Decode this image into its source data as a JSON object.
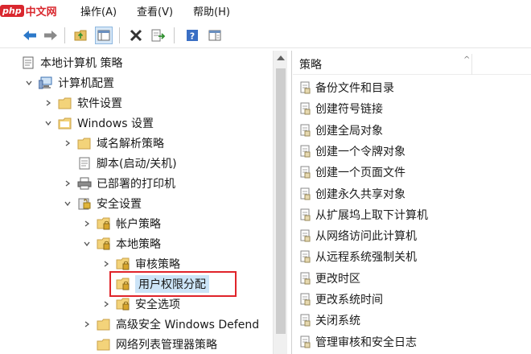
{
  "brand": {
    "badge": "php",
    "text": "中文网"
  },
  "menubar": {
    "items": [
      "操作(A)",
      "查看(V)",
      "帮助(H)"
    ]
  },
  "toolbar": {
    "icons": [
      "back-arrow-icon",
      "forward-arrow-icon",
      "up-folder-icon",
      "show-hide-tree-icon",
      "delete-icon",
      "export-list-icon",
      "help-icon",
      "properties-icon"
    ]
  },
  "tree": {
    "items": [
      {
        "label": "本地计算机 策略",
        "level": 0,
        "expander": "none",
        "icon": "policy-doc-icon"
      },
      {
        "label": "计算机配置",
        "level": 1,
        "expander": "expanded",
        "icon": "computer-icon"
      },
      {
        "label": "软件设置",
        "level": 2,
        "expander": "collapsed",
        "icon": "folder-icon"
      },
      {
        "label": "Windows 设置",
        "level": 2,
        "expander": "expanded",
        "icon": "folder-icon"
      },
      {
        "label": "域名解析策略",
        "level": 3,
        "expander": "collapsed",
        "icon": "folder-icon"
      },
      {
        "label": "脚本(启动/关机)",
        "level": 3,
        "expander": "none",
        "icon": "script-icon"
      },
      {
        "label": "已部署的打印机",
        "level": 3,
        "expander": "collapsed",
        "icon": "printer-icon"
      },
      {
        "label": "安全设置",
        "level": 3,
        "expander": "expanded",
        "icon": "security-icon"
      },
      {
        "label": "帐户策略",
        "level": 4,
        "expander": "collapsed",
        "icon": "folder-lock-icon"
      },
      {
        "label": "本地策略",
        "level": 4,
        "expander": "expanded",
        "icon": "folder-lock-icon"
      },
      {
        "label": "审核策略",
        "level": 5,
        "expander": "collapsed",
        "icon": "folder-lock-icon"
      },
      {
        "label": "用户权限分配",
        "level": 5,
        "expander": "none",
        "icon": "folder-lock-icon",
        "selected": true
      },
      {
        "label": "安全选项",
        "level": 5,
        "expander": "collapsed",
        "icon": "folder-lock-icon"
      },
      {
        "label": "高级安全 Windows Defend",
        "level": 4,
        "expander": "collapsed",
        "icon": "folder-icon"
      },
      {
        "label": "网络列表管理器策略",
        "level": 4,
        "expander": "none",
        "icon": "folder-icon"
      }
    ]
  },
  "list": {
    "header": "策略",
    "items": [
      "备份文件和目录",
      "创建符号链接",
      "创建全局对象",
      "创建一个令牌对象",
      "创建一个页面文件",
      "创建永久共享对象",
      "从扩展坞上取下计算机",
      "从网络访问此计算机",
      "从远程系统强制关机",
      "更改时区",
      "更改系统时间",
      "关闭系统",
      "管理审核和安全日志"
    ]
  },
  "colors": {
    "highlight_border": "#e0242a",
    "selection_bg": "#cce4f7",
    "brand_red": "#d9272e"
  }
}
